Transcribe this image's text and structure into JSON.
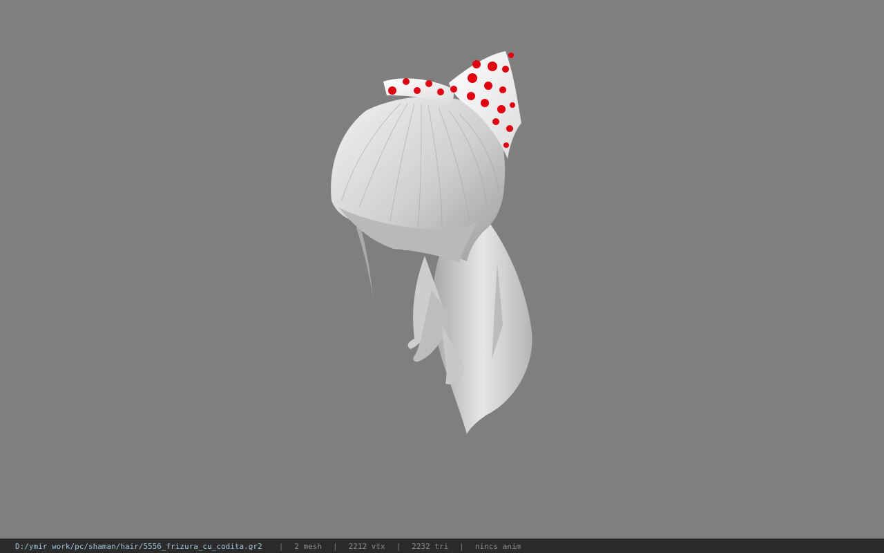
{
  "viewer": {
    "background_color": "#7f7f7f",
    "model": {
      "object": "hair model with polka-dot bow",
      "hair_color": "#d9d9d9",
      "bow_color": "#ffffff",
      "bow_dot_color": "#e3000f"
    }
  },
  "status_bar": {
    "file_path": "D:/ymir work/pc/shaman/hair/5556_frizura_cu_codita.gr2",
    "separator": "|",
    "mesh_count": "2 mesh",
    "vertex_count": "2212 vtx",
    "triangle_count": "2232 tri",
    "animation_status": "nincs anim"
  }
}
